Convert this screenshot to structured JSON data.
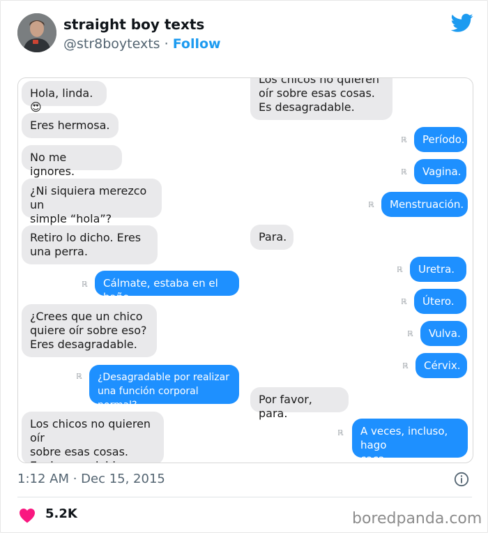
{
  "tweet": {
    "author_name": "straight boy texts",
    "handle": "@str8boytexts",
    "separator": "·",
    "follow_label": "Follow",
    "timestamp": "1:12 AM · Dec 15, 2015",
    "likes": "5.2K",
    "accent_color": "#1d9bf0",
    "like_color": "#f91880",
    "icons": [
      "twitter-bird-icon",
      "info-icon",
      "heart-icon"
    ]
  },
  "screenshot": {
    "read_receipt_glyph": "ℝ",
    "left_messages": [
      {
        "side": "gray",
        "text": "Hola, linda.😍"
      },
      {
        "side": "gray",
        "text": "Eres hermosa."
      },
      {
        "side": "gray",
        "text": "No me ignores."
      },
      {
        "side": "gray",
        "text": "¿Ni siquiera merezco un\nsimple “hola”?"
      },
      {
        "side": "gray",
        "text": "Retiro lo dicho. Eres\nuna perra."
      },
      {
        "side": "blue",
        "text": "Cálmate, estaba en el baño."
      },
      {
        "side": "gray",
        "text": "¿Crees que un chico\nquiere oír sobre eso?\nEres desagradable."
      },
      {
        "side": "blue",
        "text": "¿Desagradable por realizar\nuna función corporal normal?"
      },
      {
        "side": "gray",
        "text": "Los chicos no quieren oír\nsobre esas cosas.\nEs desagradable."
      }
    ],
    "right_messages": [
      {
        "side": "gray",
        "text": "Los chicos no quieren\noír sobre esas cosas.\nEs desagradable."
      },
      {
        "side": "blue",
        "text": "Período."
      },
      {
        "side": "blue",
        "text": "Vagina."
      },
      {
        "side": "blue",
        "text": "Menstruación."
      },
      {
        "side": "gray",
        "text": "Para."
      },
      {
        "side": "blue",
        "text": "Uretra."
      },
      {
        "side": "blue",
        "text": "Útero."
      },
      {
        "side": "blue",
        "text": "Vulva."
      },
      {
        "side": "blue",
        "text": "Cérvix."
      },
      {
        "side": "gray",
        "text": "Por favor, para."
      },
      {
        "side": "blue",
        "text": "A veces, incluso, hago\ncaca."
      }
    ]
  },
  "watermark": "boredpanda.com"
}
